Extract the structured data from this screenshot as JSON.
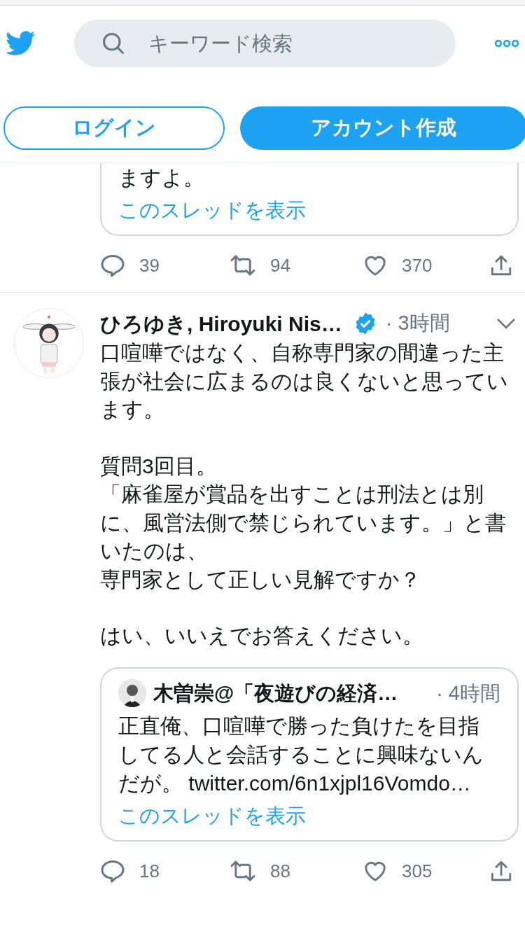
{
  "header": {
    "search": {
      "placeholder": "キーワード検索"
    },
    "buttons": [
      {
        "label": "ログイン",
        "kind": "outline"
      },
      {
        "label": "アカウント作成",
        "kind": "filled"
      }
    ]
  },
  "tweets": [
    {
      "quote": {
        "lines": [
          "ますよ。"
        ],
        "cut_top": true,
        "thread_link": "このスレッドを表示"
      },
      "actions": {
        "replies": "39",
        "retweets": "94",
        "likes": "370"
      }
    },
    {
      "name": "ひろゆき, Hiroyuki Nis…",
      "verified": true,
      "time": "· 3時間",
      "body": [
        [
          "口喧嘩ではなく、自称専門家の間違った主張が社会に広まるのは良くないと思っています。"
        ],
        [
          "質問3回目。",
          "「麻雀屋が賞品を出すことは刑法とは別に、風営法側で禁じられています。」と書いたのは、",
          "専門家として正しい見解ですか？"
        ],
        [
          "はい、いいえでお答えください。"
        ]
      ],
      "quote": {
        "name": "木曽崇@「夜遊びの経済…",
        "time": "· 4時間",
        "lines": [
          "正直俺、口喧嘩で勝った負けたを目指してる人と会話することに興味ないんだが。 twitter.com/6n1xjpl16Vomdo…"
        ],
        "cut_top": false,
        "thread_link": "このスレッドを表示"
      },
      "actions": {
        "replies": "18",
        "retweets": "88",
        "likes": "305"
      }
    }
  ]
}
